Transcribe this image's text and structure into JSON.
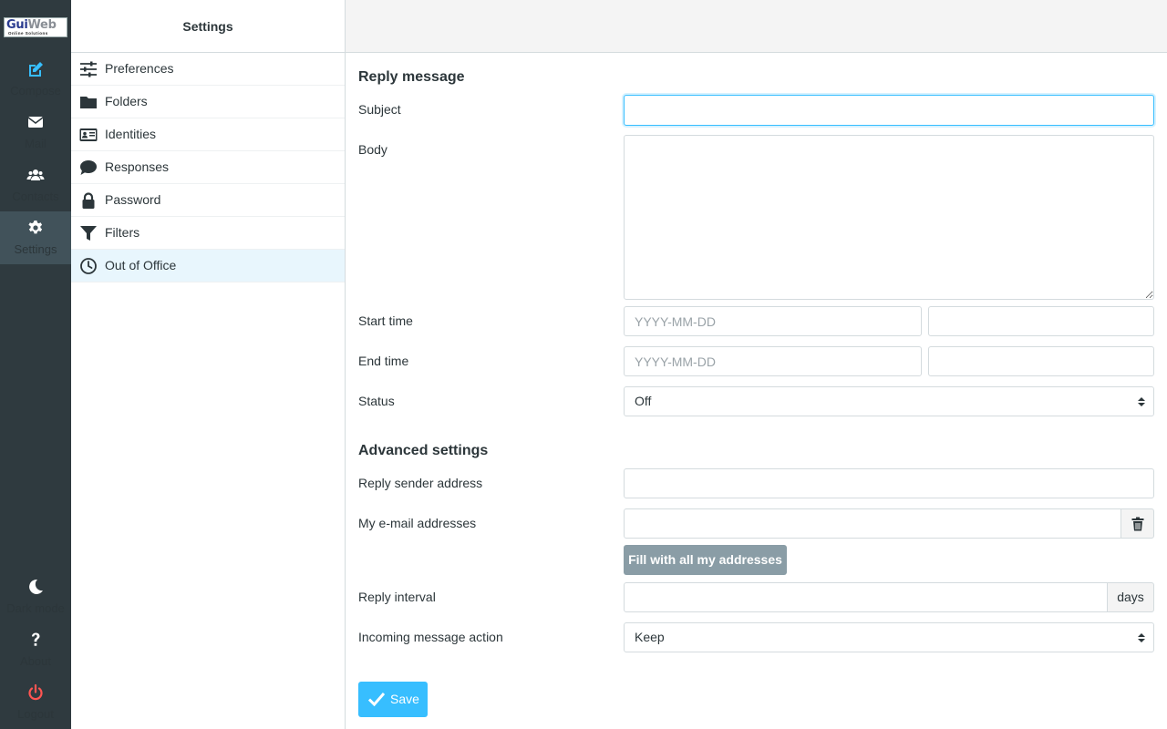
{
  "app": {
    "logo_text_1": "Gui",
    "logo_text_2": "Web",
    "logo_tagline": "Online Solutions",
    "accent_color": "#37beff",
    "danger_color": "#ff5552"
  },
  "nav": {
    "compose": {
      "label": "Compose",
      "icon": "compose-icon"
    },
    "mail": {
      "label": "Mail",
      "icon": "envelope-icon"
    },
    "contacts": {
      "label": "Contacts",
      "icon": "users-icon"
    },
    "settings": {
      "label": "Settings",
      "icon": "gear-icon",
      "active": true
    },
    "darkmode": {
      "label": "Dark mode",
      "icon": "moon-icon"
    },
    "about": {
      "label": "About",
      "icon": "question-icon"
    },
    "logout": {
      "label": "Logout",
      "icon": "power-icon"
    }
  },
  "settings_list": {
    "title": "Settings",
    "items": [
      {
        "label": "Preferences",
        "icon": "sliders-icon"
      },
      {
        "label": "Folders",
        "icon": "folder-icon"
      },
      {
        "label": "Identities",
        "icon": "id-card-icon"
      },
      {
        "label": "Responses",
        "icon": "comment-icon"
      },
      {
        "label": "Password",
        "icon": "lock-icon"
      },
      {
        "label": "Filters",
        "icon": "filter-icon"
      },
      {
        "label": "Out of Office",
        "icon": "clock-icon",
        "selected": true
      }
    ]
  },
  "form": {
    "reply_heading": "Reply message",
    "subject_label": "Subject",
    "subject_value": "",
    "body_label": "Body",
    "body_value": "",
    "start_label": "Start time",
    "start_date_placeholder": "YYYY-MM-DD",
    "end_label": "End time",
    "end_date_placeholder": "YYYY-MM-DD",
    "status_label": "Status",
    "status_value": "Off",
    "advanced_heading": "Advanced settings",
    "sender_label": "Reply sender address",
    "addresses_label": "My e-mail addresses",
    "fill_button": "Fill with all my addresses",
    "interval_label": "Reply interval",
    "interval_unit": "days",
    "action_label": "Incoming message action",
    "action_value": "Keep",
    "save_button": "Save"
  }
}
